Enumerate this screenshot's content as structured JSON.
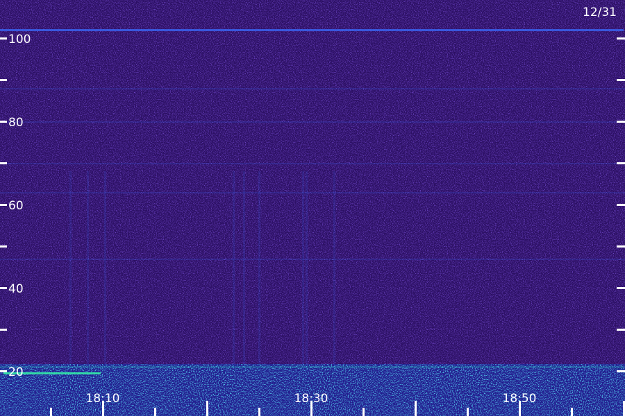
{
  "date_label": "12/31",
  "chart_data": {
    "type": "heatmap",
    "title": "",
    "xlabel": "",
    "ylabel": "",
    "y_ticks_labeled": [
      20,
      40,
      60,
      80,
      100
    ],
    "y_ticks_minor": [
      30,
      50,
      70,
      90
    ],
    "y_range": [
      13,
      105
    ],
    "x_ticks_labeled": [
      "18:10",
      "18:30",
      "18:50"
    ],
    "x_range": [
      "18:00",
      "18:60"
    ],
    "bright_bands": [
      {
        "y": 102,
        "x_start": "18:00",
        "x_end": "18:60"
      },
      {
        "y": 21,
        "x_start": "18:00",
        "x_end": "18:60"
      }
    ],
    "background_color": "#2c1064",
    "band_color": "#3a6cff",
    "bright_color": "#33ffa8"
  }
}
